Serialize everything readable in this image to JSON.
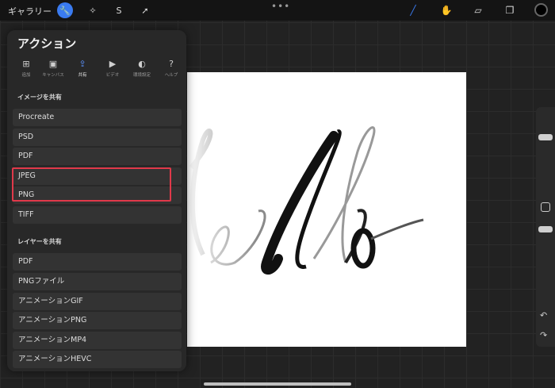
{
  "topbar": {
    "gallery_label": "ギャラリー",
    "more": "•••"
  },
  "panel": {
    "title": "アクション",
    "tabs": [
      {
        "label": "追加",
        "icon": "add-image-icon"
      },
      {
        "label": "キャンバス",
        "icon": "canvas-icon"
      },
      {
        "label": "共有",
        "icon": "share-icon",
        "active": true
      },
      {
        "label": "ビデオ",
        "icon": "play-icon"
      },
      {
        "label": "環境設定",
        "icon": "toggle-icon"
      },
      {
        "label": "ヘルプ",
        "icon": "help-icon"
      }
    ],
    "share_image_heading": "イメージを共有",
    "image_formats": [
      "Procreate",
      "PSD",
      "PDF",
      "JPEG",
      "PNG",
      "TIFF"
    ],
    "share_layer_heading": "レイヤーを共有",
    "layer_formats": [
      "PDF",
      "PNGファイル",
      "アニメーションGIF",
      "アニメーションPNG",
      "アニメーションMP4",
      "アニメーションHEVC"
    ]
  },
  "colors": {
    "accent": "#3a7bf0",
    "highlight": "#e0394a",
    "panel_bg": "#282828"
  }
}
